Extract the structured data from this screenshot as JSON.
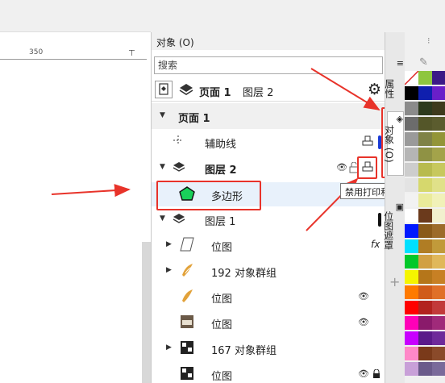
{
  "ruler": {
    "mark": "350"
  },
  "panel": {
    "title": "对象 (O)",
    "search_placeholder": "搜索",
    "page_label": "页面 1",
    "layer_label": "图层 2"
  },
  "rows": {
    "page1": "页面 1",
    "guides": "辅助线",
    "layer2": "图层 2",
    "polygon": "多边形",
    "layer1": "图层 1",
    "bitmap1": "位图",
    "group192": "192 对象群组",
    "bitmap2": "位图",
    "bitmap3": "位图",
    "group167": "167 对象群组",
    "bitmap4": "位图"
  },
  "tooltip": {
    "text": "禁用打印和导出(&D)"
  },
  "tabs": {
    "properties": "属性",
    "objects": "对象 (O)",
    "bitmap_mask": "位图遮罩"
  },
  "icons": {
    "gear": "gear-icon",
    "eye": "eye-icon",
    "printer": "printer-icon",
    "lock": "lock-icon",
    "fx": "fx-icon",
    "layers": "layers-icon"
  },
  "colors": {
    "annotation_red": "#e8332a",
    "polygon_green": "#19d15a",
    "layer2_bar": "#1a3bd6",
    "selection": "#e8f1fb"
  },
  "palette": [
    [
      "#ffffff",
      "#8ec63f",
      "#3b1a87"
    ],
    [
      "#000000",
      "#0f1fae",
      "#6a1fc9"
    ],
    [
      "#8b8b8b",
      "#2d3a1d",
      "#3e3a1c"
    ],
    [
      "#6c6c6c",
      "#545629",
      "#5b5c2e"
    ],
    [
      "#9a9a9a",
      "#7f8246",
      "#939538"
    ],
    [
      "#b5b5b5",
      "#8f9244",
      "#a3a34a"
    ],
    [
      "#cdcdcd",
      "#b8bb4e",
      "#c7c85d"
    ],
    [
      "#e3e3e3",
      "#d6d86d",
      "#e0e189"
    ],
    [
      "#f2f2f2",
      "#eaeb9a",
      "#f1f1b8"
    ],
    [
      "#ffffff",
      "#6b3a1c",
      "#f2f0ce"
    ],
    [
      "#0019ff",
      "#8a5a1a",
      "#9c6b2a"
    ],
    [
      "#00e0ff",
      "#b07d24",
      "#c19a3a"
    ],
    [
      "#00c82a",
      "#d1a042",
      "#e0b85a"
    ],
    [
      "#f5f500",
      "#b5761a",
      "#c78024"
    ],
    [
      "#ff7a00",
      "#d05b1a",
      "#e07028"
    ],
    [
      "#ff0000",
      "#b2231f",
      "#c23a3a"
    ],
    [
      "#ff00b8",
      "#8a1a6b",
      "#a02a7a"
    ],
    [
      "#c800ff",
      "#5a1a8a",
      "#6e2a9a"
    ],
    [
      "#ff88c8",
      "#7a3a1a",
      "#8a4a2a"
    ],
    [
      "#c8a0d8",
      "#6a5a8a",
      "#7a6a9a"
    ]
  ]
}
